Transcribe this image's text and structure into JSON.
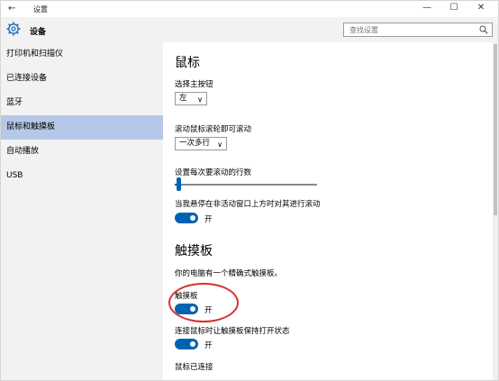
{
  "window": {
    "back_glyph": "←",
    "title": "设置",
    "minimize_glyph": "—",
    "maximize_glyph": "☐",
    "close_glyph": "✕"
  },
  "sidebar": {
    "header_label": "设备",
    "items": [
      {
        "label": "打印机和扫描仪"
      },
      {
        "label": "已连接设备"
      },
      {
        "label": "蓝牙"
      },
      {
        "label": "鼠标和触摸板"
      },
      {
        "label": "自动播放"
      },
      {
        "label": "USB"
      }
    ],
    "active_index": 3
  },
  "search": {
    "placeholder": "查找设置"
  },
  "mouse": {
    "heading": "鼠标",
    "primary_button_label": "选择主按钮",
    "primary_button_value": "左",
    "scroll_label": "滚动鼠标滚轮即可滚动",
    "scroll_value": "一次多行",
    "lines_label": "设置每次要滚动的行数",
    "lines_slider_fraction": 0.03,
    "inactive_scroll_label": "当我悬停在非活动窗口上方时对其进行滚动",
    "inactive_scroll_state": "开"
  },
  "touchpad": {
    "heading": "触摸板",
    "description": "你的电脑有一个精确式触摸板。",
    "touchpad_label": "触摸板",
    "touchpad_state": "开",
    "keep_on_label": "连接鼠标时让触摸板保持打开状态",
    "keep_on_state": "开",
    "mouse_connected_label": "鼠标已连接"
  },
  "colors": {
    "accent": "#0063b1",
    "sidebar_bg": "#f2f2f2",
    "selected_bg": "#b5c8e8",
    "annotation": "#d83030"
  }
}
